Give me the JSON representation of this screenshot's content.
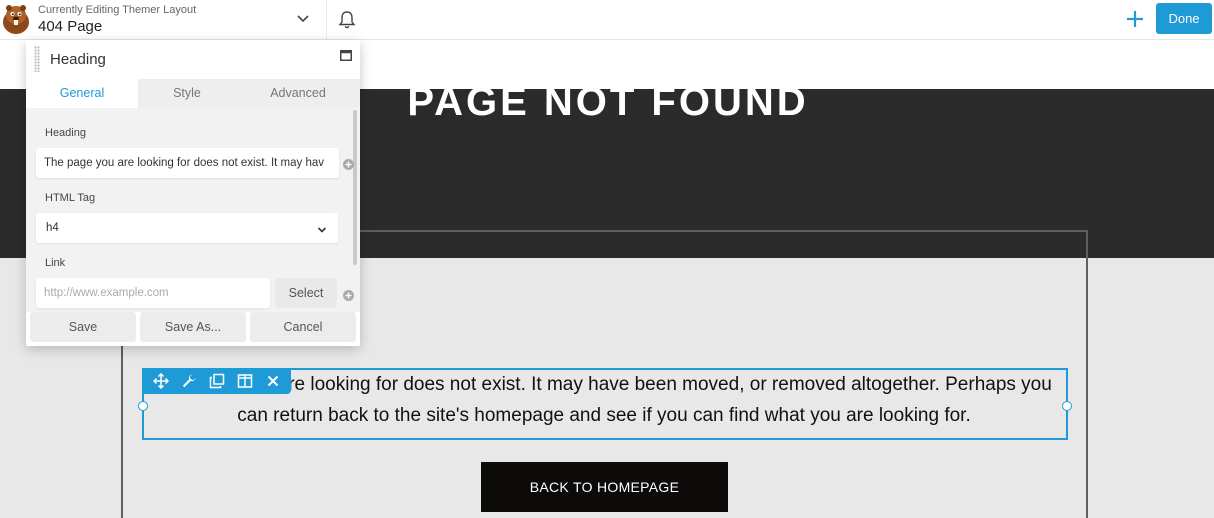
{
  "topbar": {
    "subtitle": "Currently Editing Themer Layout",
    "title": "404 Page",
    "done_label": "Done"
  },
  "page": {
    "title": "PAGE NOT FOUND",
    "body_text": "The page you are looking for does not exist. It may have been moved, or removed altogether. Perhaps you can return back to the site's homepage and see if you can find what you are looking for.",
    "button_label": "BACK TO HOMEPAGE"
  },
  "panel": {
    "title": "Heading",
    "tabs": [
      {
        "label": "General",
        "active": true
      },
      {
        "label": "Style",
        "active": false
      },
      {
        "label": "Advanced",
        "active": false
      }
    ],
    "fields": {
      "heading_label": "Heading",
      "heading_value": "The page you are looking for does not exist. It may hav",
      "html_tag_label": "HTML Tag",
      "html_tag_value": "h4",
      "link_label": "Link",
      "link_placeholder": "http://www.example.com",
      "select_label": "Select"
    },
    "footer": {
      "save": "Save",
      "save_as": "Save As...",
      "cancel": "Cancel"
    }
  },
  "colors": {
    "accent": "#1e9ad6",
    "dark_band": "#2b2b2b",
    "content_bg": "#e8e8e8",
    "button_bg": "#0d0a0a"
  }
}
